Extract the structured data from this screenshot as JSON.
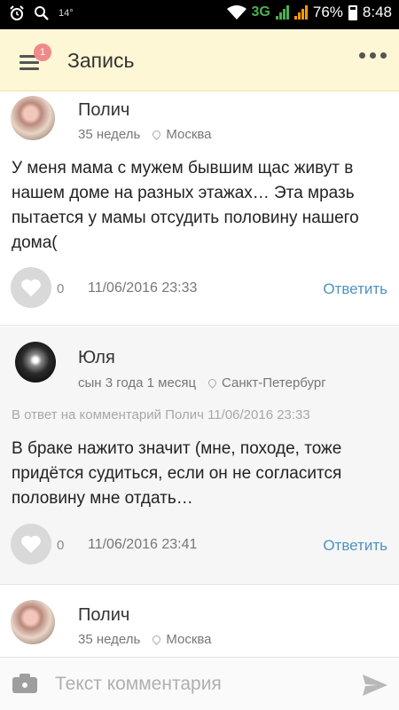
{
  "status_bar": {
    "temperature": "14°",
    "network": "3G",
    "battery": "76%",
    "time": "8:48"
  },
  "header": {
    "title": "Запись",
    "menu_badge": "1"
  },
  "comments": [
    {
      "author": "Полич",
      "meta": "35 недель",
      "location": "Москва",
      "body": "У меня мама с мужем бывшим щас живут в нашем доме на разных этажах… Эта мразь пытается у мамы отсудить половину нашего дома(",
      "likes": "0",
      "date": "11/06/2016 23:33",
      "reply_label": "Ответить"
    },
    {
      "author": "Юля",
      "meta": "сын 3 года 1 месяц",
      "location": "Санкт-Петербург",
      "reply_to": "В ответ на комментарий Полич  11/06/2016 23:33",
      "body": "В браке нажито значит (мне, походе, тоже придётся судиться, если он не согласится половину мне отдать…",
      "likes": "0",
      "date": "11/06/2016 23:41",
      "reply_label": "Ответить"
    },
    {
      "author": "Полич",
      "meta": "35 недель",
      "location": "Москва"
    }
  ],
  "comment_input": {
    "placeholder": "Текст комментария"
  },
  "colors": {
    "header_bg": "#fdf7d5",
    "reply_link": "#4d93c0",
    "badge": "#f08a8a"
  }
}
